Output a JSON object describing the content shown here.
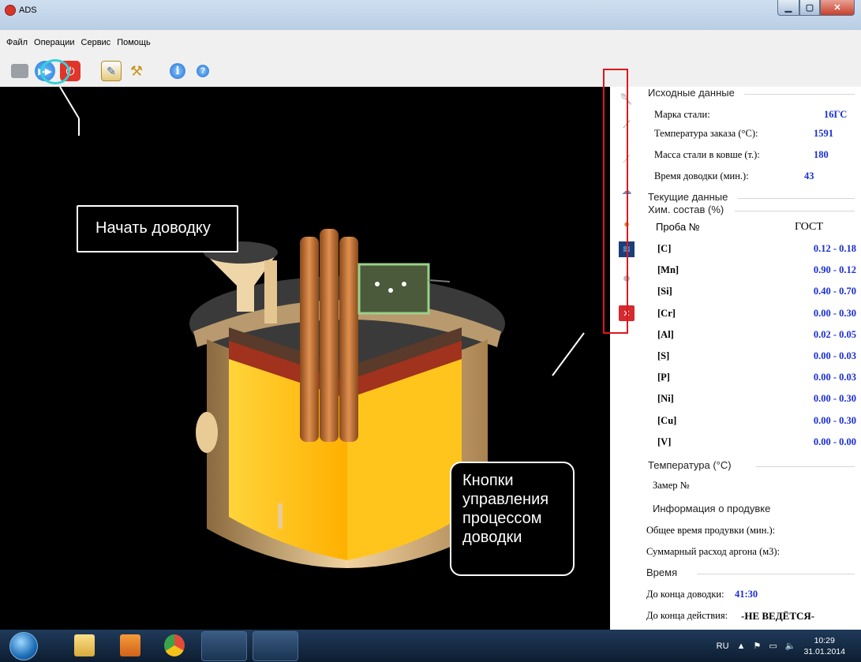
{
  "window": {
    "title": "ADS"
  },
  "menu": [
    "Файл",
    "Операции",
    "Сервис",
    "Помощь"
  ],
  "toolbar": {
    "icons": [
      "folder-icon",
      "start-icon",
      "power-icon",
      "edit-icon",
      "tools-icon",
      "info-icon",
      "help-icon"
    ],
    "start_glyph": "▶▶",
    "power_glyph": "⏻",
    "info_glyph": "i",
    "help_glyph": "?"
  },
  "callouts": {
    "start": "Начать доводку",
    "buttons": [
      "Кнопки",
      "управления",
      "процессом",
      "доводки"
    ]
  },
  "side_buttons": [
    "ladle-icon",
    "probe-icon",
    "wire-icon",
    "alloy-icon",
    "globe-icon",
    "chart-icon",
    "gas-icon",
    "close-icon"
  ],
  "panel": {
    "initial": {
      "title": "Исходные данные",
      "rows": [
        {
          "label": "Марка стали:",
          "value": "16ГС"
        },
        {
          "label": "Температура заказа (°С):",
          "value": "1591"
        },
        {
          "label": "Масса стали в ковше (т.):",
          "value": "180"
        },
        {
          "label": "Время доводки (мин.):",
          "value": "43"
        }
      ]
    },
    "current_title": "Текущие данные",
    "chem": {
      "title": "Хим. состав (%)",
      "col_probe": "Проба №",
      "col_gost": "ГОСТ",
      "rows": [
        {
          "el": "[C]",
          "range": "0.12 - 0.18"
        },
        {
          "el": "[Mn]",
          "range": "0.90 - 0.12"
        },
        {
          "el": "[Si]",
          "range": "0.40 - 0.70"
        },
        {
          "el": "[Cr]",
          "range": "0.00 - 0.30"
        },
        {
          "el": "[Al]",
          "range": "0.02 - 0.05"
        },
        {
          "el": "[S]",
          "range": "0.00 - 0.03"
        },
        {
          "el": "[P]",
          "range": "0.00 - 0.03"
        },
        {
          "el": "[Ni]",
          "range": "0.00 - 0.30"
        },
        {
          "el": "[Cu]",
          "range": "0.00 - 0.30"
        },
        {
          "el": "[V]",
          "range": "0.00 - 0.00"
        }
      ]
    },
    "temp": {
      "title": "Температура (°С)",
      "measure": "Замер №"
    },
    "blow": {
      "title": "Информация о продувке",
      "total_time": "Общее время продувки (мин.):",
      "argon": "Суммарный расход аргона (м3):"
    },
    "time": {
      "title": "Время",
      "to_end_label": "До конца доводки:",
      "to_end_value": "41:30",
      "action_label": "До конца действия:",
      "action_value": "-НЕ ВЕДЁТСЯ-"
    }
  },
  "taskbar": {
    "lang": "RU",
    "time": "10:29",
    "date": "31.01.2014"
  },
  "colors": {
    "accent_value": "#1a2fd6",
    "callout_frame": "#e0161c",
    "start_ring": "#38d0d8"
  }
}
